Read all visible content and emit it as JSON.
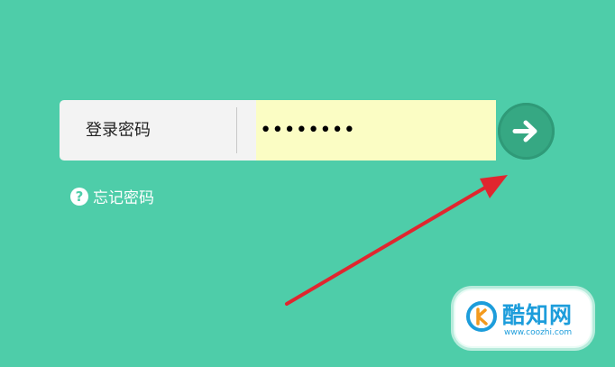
{
  "login": {
    "label": "登录密码",
    "password_value": "••••••••"
  },
  "forgot": {
    "icon": "help-icon",
    "icon_glyph": "?",
    "label": "忘记密码"
  },
  "submit": {
    "icon": "arrow-right-icon"
  },
  "annotation": {
    "icon": "red-arrow-icon",
    "color": "#e0262f"
  },
  "watermark": {
    "name": "酷知网",
    "url": "www.coozhi.com"
  },
  "colors": {
    "background": "#4ecda9",
    "input_fill": "#fbfdc4",
    "button": "#36a883",
    "brand": "#1d9ddb"
  }
}
